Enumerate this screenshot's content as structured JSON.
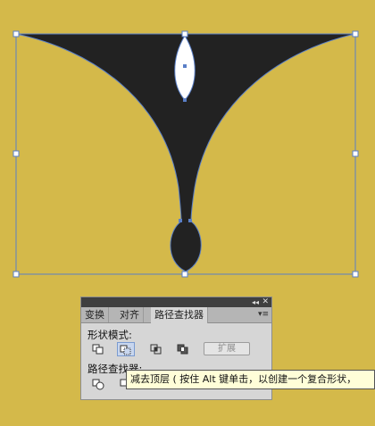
{
  "colors": {
    "background": "#d4b94a",
    "shape_fill": "#222222",
    "selection_stroke": "#5a7fc7",
    "panel_bg": "#d6d6d6"
  },
  "panel": {
    "tabs": [
      "变换",
      "对齐",
      "路径查找器"
    ],
    "active_tab": "路径查找器",
    "shape_modes_label": "形状模式:",
    "shape_mode_buttons": [
      "unite-icon",
      "minus-front-icon",
      "intersect-icon",
      "exclude-icon"
    ],
    "selected_shape_mode": "minus-front-icon",
    "expand_label": "扩展",
    "pathfinders_label": "路径查找器:",
    "collapse_icon": "double-chevron-icon",
    "close_icon": "close-icon",
    "menu_icon": "panel-menu-icon"
  },
  "tooltip": {
    "text": "减去顶层 ( 按住 Alt 键单击，以创建一个复合形状，"
  }
}
